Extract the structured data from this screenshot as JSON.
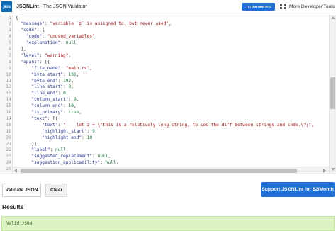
{
  "header": {
    "logo_text": "JSON",
    "brand_name": "JSONLint",
    "brand_separator": " - ",
    "brand_tagline": "The JSON Validator",
    "try_button": "Try the New Pro",
    "more_tools": "More Developer Tools"
  },
  "editor": {
    "line_numbers": [
      "1",
      "2",
      "3",
      "4",
      "5",
      "6",
      "7",
      "8",
      "9",
      "10",
      "11",
      "12",
      "13",
      "14",
      "15",
      "16",
      "17",
      "18",
      "19",
      "20",
      "21",
      "22",
      "23",
      "24",
      "25"
    ],
    "folded_lines": [
      1,
      3,
      8,
      17
    ],
    "lines": [
      [
        [
          "p",
          "{"
        ]
      ],
      [
        [
          "p",
          "  "
        ],
        [
          "k",
          "\"message\""
        ],
        [
          "p",
          ": "
        ],
        [
          "s",
          "\"variable `z` is assigned to, but never used\""
        ],
        [
          "p",
          ","
        ]
      ],
      [
        [
          "p",
          "  "
        ],
        [
          "k",
          "\"code\""
        ],
        [
          "p",
          ": {"
        ]
      ],
      [
        [
          "p",
          "    "
        ],
        [
          "k",
          "\"code\""
        ],
        [
          "p",
          ": "
        ],
        [
          "s",
          "\"unused_variables\""
        ],
        [
          "p",
          ","
        ]
      ],
      [
        [
          "p",
          "    "
        ],
        [
          "k",
          "\"explanation\""
        ],
        [
          "p",
          ": "
        ],
        [
          "l",
          "null"
        ]
      ],
      [
        [
          "p",
          "  },"
        ]
      ],
      [
        [
          "p",
          "  "
        ],
        [
          "k",
          "\"level\""
        ],
        [
          "p",
          ": "
        ],
        [
          "s",
          "\"warning\""
        ],
        [
          "p",
          ","
        ]
      ],
      [
        [
          "p",
          "  "
        ],
        [
          "k",
          "\"spans\""
        ],
        [
          "p",
          ": [{"
        ]
      ],
      [
        [
          "p",
          "      "
        ],
        [
          "k",
          "\"file_name\""
        ],
        [
          "p",
          ": "
        ],
        [
          "s",
          "\"main.rs\""
        ],
        [
          "p",
          ","
        ]
      ],
      [
        [
          "p",
          "      "
        ],
        [
          "k",
          "\"byte_start\""
        ],
        [
          "p",
          ": "
        ],
        [
          "n",
          "191"
        ],
        [
          "p",
          ","
        ]
      ],
      [
        [
          "p",
          "      "
        ],
        [
          "k",
          "\"byte_end\""
        ],
        [
          "p",
          ": "
        ],
        [
          "n",
          "192"
        ],
        [
          "p",
          ","
        ]
      ],
      [
        [
          "p",
          "      "
        ],
        [
          "k",
          "\"line_start\""
        ],
        [
          "p",
          ": "
        ],
        [
          "n",
          "8"
        ],
        [
          "p",
          ","
        ]
      ],
      [
        [
          "p",
          "      "
        ],
        [
          "k",
          "\"line_end\""
        ],
        [
          "p",
          ": "
        ],
        [
          "n",
          "8"
        ],
        [
          "p",
          ","
        ]
      ],
      [
        [
          "p",
          "      "
        ],
        [
          "k",
          "\"column_start\""
        ],
        [
          "p",
          ": "
        ],
        [
          "n",
          "9"
        ],
        [
          "p",
          ","
        ]
      ],
      [
        [
          "p",
          "      "
        ],
        [
          "k",
          "\"column_end\""
        ],
        [
          "p",
          ": "
        ],
        [
          "n",
          "10"
        ],
        [
          "p",
          ","
        ]
      ],
      [
        [
          "p",
          "      "
        ],
        [
          "k",
          "\"is_primary\""
        ],
        [
          "p",
          ": "
        ],
        [
          "l",
          "true"
        ],
        [
          "p",
          ","
        ]
      ],
      [
        [
          "p",
          "      "
        ],
        [
          "k",
          "\"text\""
        ],
        [
          "p",
          ": [{"
        ]
      ],
      [
        [
          "p",
          "          "
        ],
        [
          "k",
          "\"text\""
        ],
        [
          "p",
          ": "
        ],
        [
          "s",
          "\"    let z = \\\"this is a relatively long string, to see the diff between strings and code.\\\";\","
        ]
      ],
      [
        [
          "p",
          "          "
        ],
        [
          "k",
          "\"highlight_start\""
        ],
        [
          "p",
          ": "
        ],
        [
          "n",
          "9"
        ],
        [
          "p",
          ","
        ]
      ],
      [
        [
          "p",
          "          "
        ],
        [
          "k",
          "\"highlight_end\""
        ],
        [
          "p",
          ": "
        ],
        [
          "n",
          "10"
        ]
      ],
      [
        [
          "p",
          "      }],"
        ]
      ],
      [
        [
          "p",
          "      "
        ],
        [
          "k",
          "\"label\""
        ],
        [
          "p",
          ": "
        ],
        [
          "l",
          "null"
        ],
        [
          "p",
          ","
        ]
      ],
      [
        [
          "p",
          "      "
        ],
        [
          "k",
          "\"suggested_replacement\""
        ],
        [
          "p",
          ": "
        ],
        [
          "l",
          "null"
        ],
        [
          "p",
          ","
        ]
      ],
      [
        [
          "p",
          "      "
        ],
        [
          "k",
          "\"suggestion_applicability\""
        ],
        [
          "p",
          ": "
        ],
        [
          "l",
          "null"
        ],
        [
          "p",
          ","
        ]
      ],
      [
        [
          "p",
          "      "
        ],
        [
          "k",
          "\"expansion\""
        ],
        [
          "p",
          ": "
        ],
        [
          "l",
          "null"
        ]
      ]
    ]
  },
  "actions": {
    "validate": "Validate JSON",
    "clear": "Clear",
    "support": "Support JSONLint for $2/Month"
  },
  "results": {
    "title": "Results",
    "message": "Valid JSON"
  }
}
